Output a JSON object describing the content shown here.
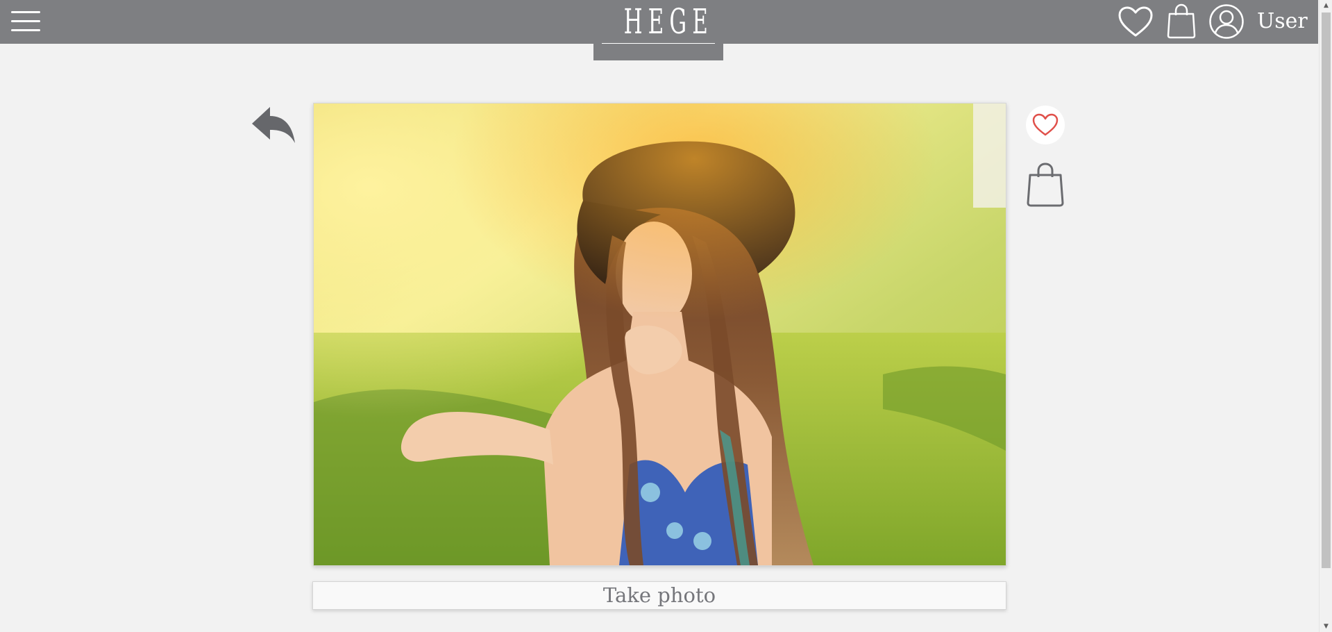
{
  "header": {
    "logo": "HEGE",
    "user_label": "User",
    "icons": [
      "menu-icon",
      "heart-icon",
      "shopping-bag-icon",
      "user-icon"
    ],
    "background_color": "#7e7f82"
  },
  "toolbar": {
    "back_icon": "reply-arrow-icon",
    "favorite_icon": "heart-outline-icon",
    "favorite_color": "#e0504a",
    "bag_icon": "shopping-bag-icon"
  },
  "photo": {
    "description_icon": "photo"
  },
  "actions": {
    "take_photo_label": "Take photo"
  },
  "colors": {
    "page_background": "#f2f2f2",
    "icon_gray": "#6b6c70"
  }
}
